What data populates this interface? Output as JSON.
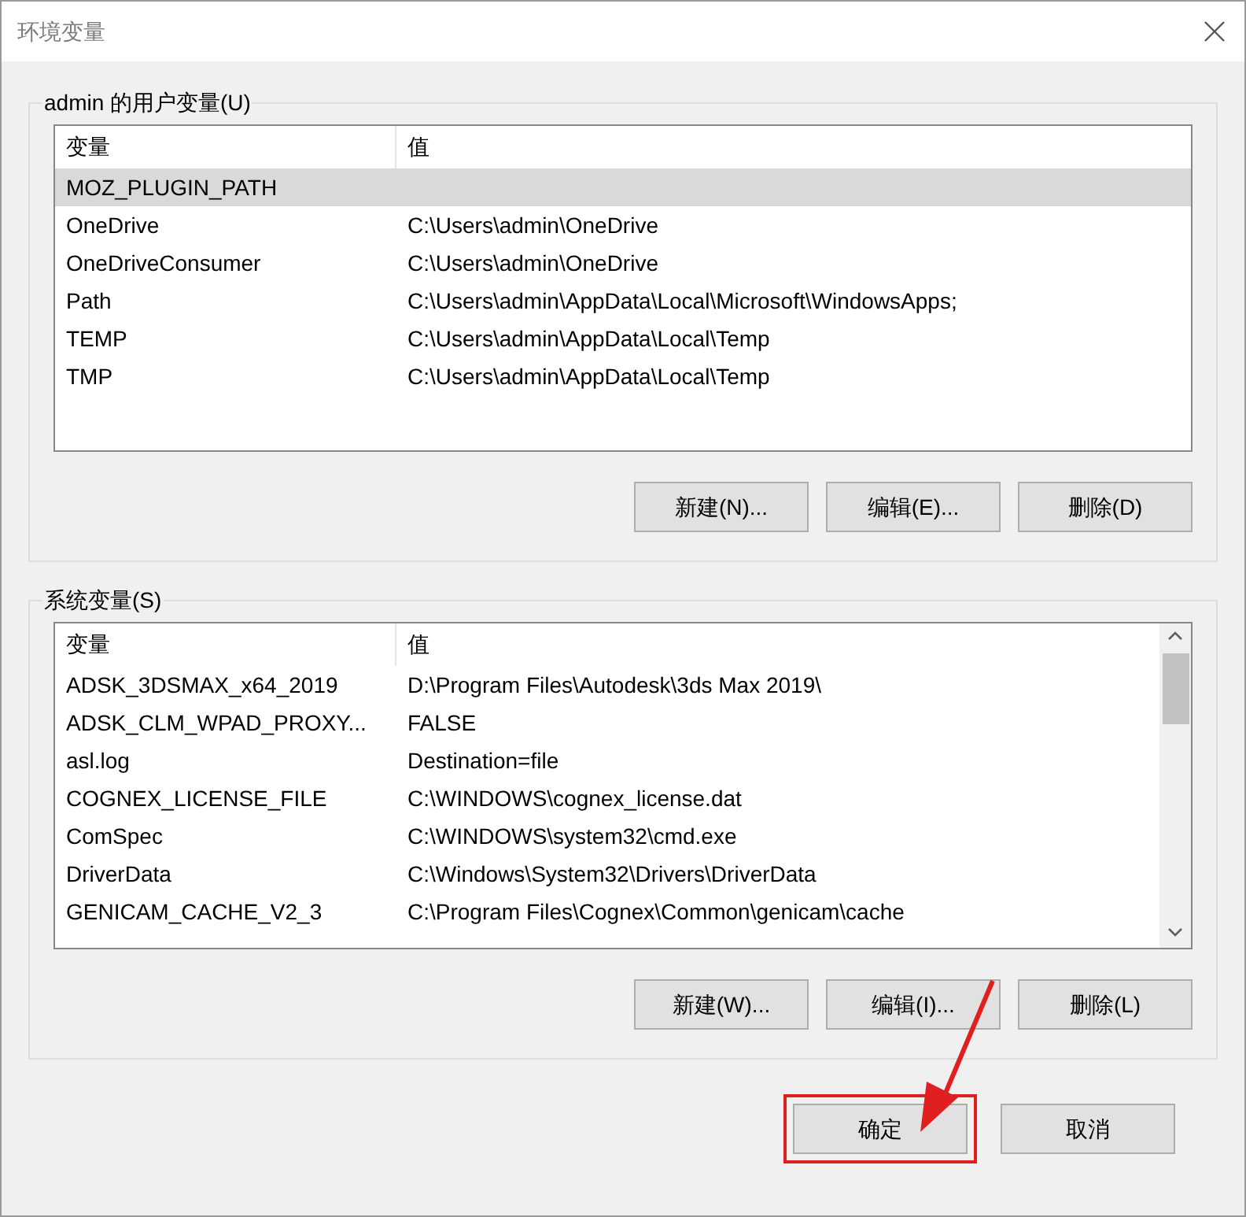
{
  "window": {
    "title": "环境变量"
  },
  "user_vars": {
    "title": "admin 的用户变量(U)",
    "columns": [
      "变量",
      "值"
    ],
    "rows": [
      {
        "name": "MOZ_PLUGIN_PATH",
        "value": "",
        "selected": true
      },
      {
        "name": "OneDrive",
        "value": "C:\\Users\\admin\\OneDrive",
        "selected": false
      },
      {
        "name": "OneDriveConsumer",
        "value": "C:\\Users\\admin\\OneDrive",
        "selected": false
      },
      {
        "name": "Path",
        "value": "C:\\Users\\admin\\AppData\\Local\\Microsoft\\WindowsApps;",
        "selected": false
      },
      {
        "name": "TEMP",
        "value": "C:\\Users\\admin\\AppData\\Local\\Temp",
        "selected": false
      },
      {
        "name": "TMP",
        "value": "C:\\Users\\admin\\AppData\\Local\\Temp",
        "selected": false
      }
    ],
    "buttons": [
      "新建(N)...",
      "编辑(E)...",
      "删除(D)"
    ]
  },
  "system_vars": {
    "title": "系统变量(S)",
    "columns": [
      "变量",
      "值"
    ],
    "rows": [
      {
        "name": "ADSK_3DSMAX_x64_2019",
        "value": "D:\\Program Files\\Autodesk\\3ds Max 2019\\",
        "selected": false
      },
      {
        "name": "ADSK_CLM_WPAD_PROXY...",
        "value": "FALSE",
        "selected": false
      },
      {
        "name": "asl.log",
        "value": "Destination=file",
        "selected": false
      },
      {
        "name": "COGNEX_LICENSE_FILE",
        "value": "C:\\WINDOWS\\cognex_license.dat",
        "selected": false
      },
      {
        "name": "ComSpec",
        "value": "C:\\WINDOWS\\system32\\cmd.exe",
        "selected": false
      },
      {
        "name": "DriverData",
        "value": "C:\\Windows\\System32\\Drivers\\DriverData",
        "selected": false
      },
      {
        "name": "GENICAM_CACHE_V2_3",
        "value": "C:\\Program Files\\Cognex\\Common\\genicam\\cache",
        "selected": false
      }
    ],
    "buttons": [
      "新建(W)...",
      "编辑(I)...",
      "删除(L)"
    ]
  },
  "footer_buttons": [
    {
      "label": "确定",
      "highlighted": true
    },
    {
      "label": "取消",
      "highlighted": false
    }
  ]
}
